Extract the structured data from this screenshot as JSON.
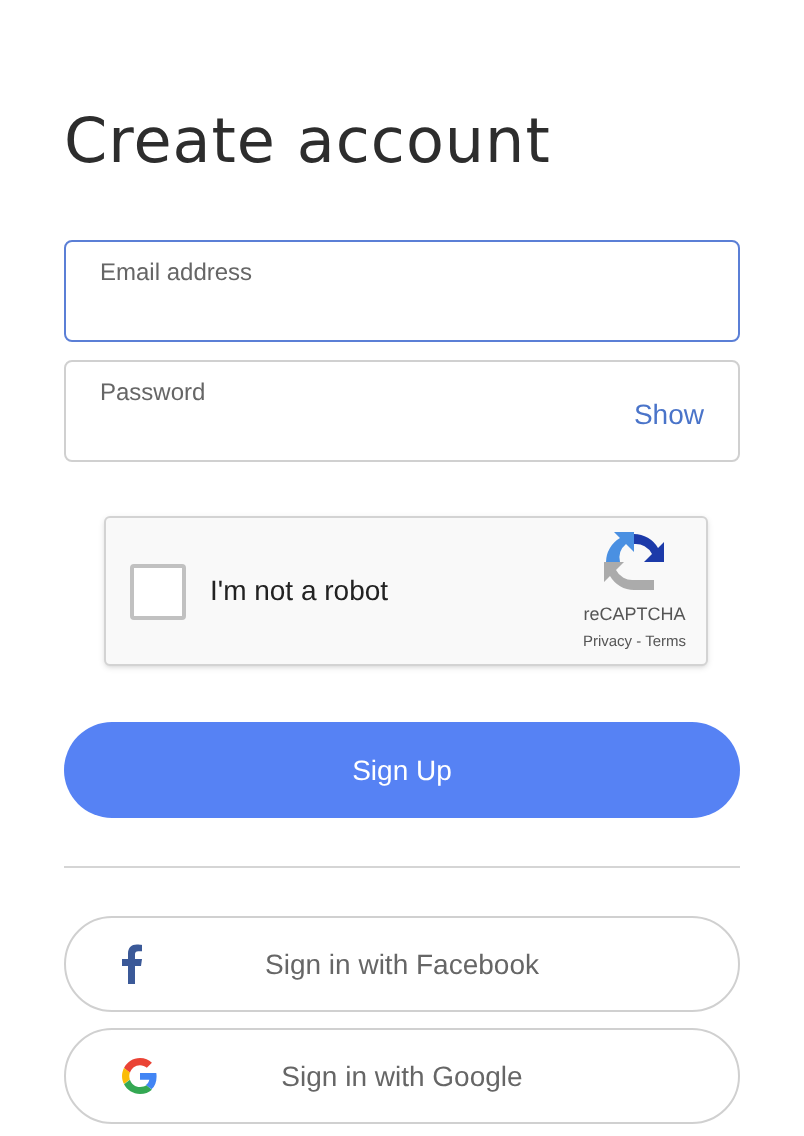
{
  "title": "Create account",
  "fields": [
    {
      "placeholder": "Email address",
      "focused": true
    },
    {
      "placeholder": "Password",
      "focused": false,
      "toggle": "Show"
    }
  ],
  "captcha": {
    "label": "I'm not a robot",
    "checked": false,
    "brand": "reCAPTCHA",
    "links": "Privacy - Terms"
  },
  "submit": "Sign Up",
  "social": [
    {
      "kind": "facebook",
      "label": "Sign in with Facebook"
    },
    {
      "kind": "google",
      "label": "Sign in with Google"
    }
  ]
}
